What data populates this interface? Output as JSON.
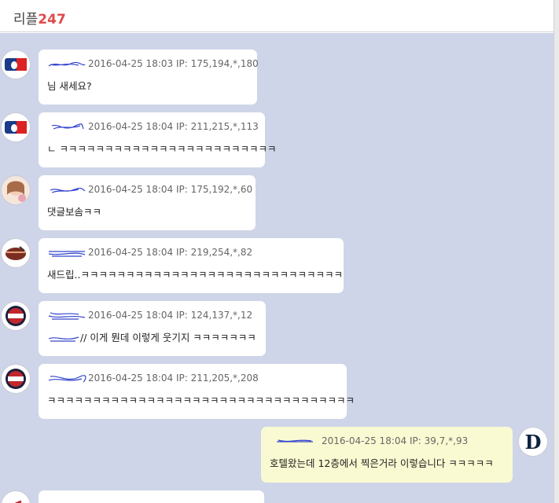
{
  "header": {
    "title": "리플",
    "count": "247"
  },
  "colors": {
    "feed_bg": "#cfd5e8",
    "accent": "#e04a4a",
    "mine_bubble": "#fafad2"
  },
  "comments": [
    {
      "avatar_icon": "mlb-logo-icon",
      "datetime": "2016-04-25 18:03",
      "ip": "IP: 175,194,*,180",
      "text": "님 새세요?"
    },
    {
      "avatar_icon": "mlb-logo-icon",
      "datetime": "2016-04-25 18:04",
      "ip": "IP: 211,215,*,113",
      "text": "ㄴ ㅋㅋㅋㅋㅋㅋㅋㅋㅋㅋㅋㅋㅋㅋㅋㅋㅋㅋㅋㅋㅋㅋㅋㅋ"
    },
    {
      "avatar_icon": "profile-photo-icon",
      "datetime": "2016-04-25 18:04",
      "ip": "IP: 175,192,*,60",
      "text": "댓글보솜ㅋㅋ"
    },
    {
      "avatar_icon": "giants-logo-icon",
      "datetime": "2016-04-25 18:04",
      "ip": "IP: 219,254,*,82",
      "text": "새드립..ㅋㅋㅋㅋㅋㅋㅋㅋㅋㅋㅋㅋㅋㅋㅋㅋㅋㅋㅋㅋㅋㅋㅋㅋㅋㅋㅋㅋㅋ"
    },
    {
      "avatar_icon": "bears-logo-icon",
      "datetime": "2016-04-25 18:04",
      "ip": "IP: 124,137,*,12",
      "text": "// 이게 뭔데 이렇게 웃기지 ㅋㅋㅋㅋㅋㅋㅋ"
    },
    {
      "avatar_icon": "bears-logo-icon",
      "datetime": "2016-04-25 18:04",
      "ip": "IP: 211,205,*,208",
      "text": "ㅋㅋㅋㅋㅋㅋㅋㅋㅋㅋㅋㅋㅋㅋㅋㅋㅋㅋㅋㅋㅋㅋㅋㅋㅋㅋㅋㅋㅋㅋㅋㅋㅋㅋ"
    },
    {
      "avatar_icon": "tigers-logo-icon",
      "datetime": "2016-04-25 18:04",
      "ip": "IP: 39,7,*,93",
      "text": "호텔왔는데 12층에서 찍은거라 이렇습니다 ㅋㅋㅋㅋㅋ"
    }
  ]
}
